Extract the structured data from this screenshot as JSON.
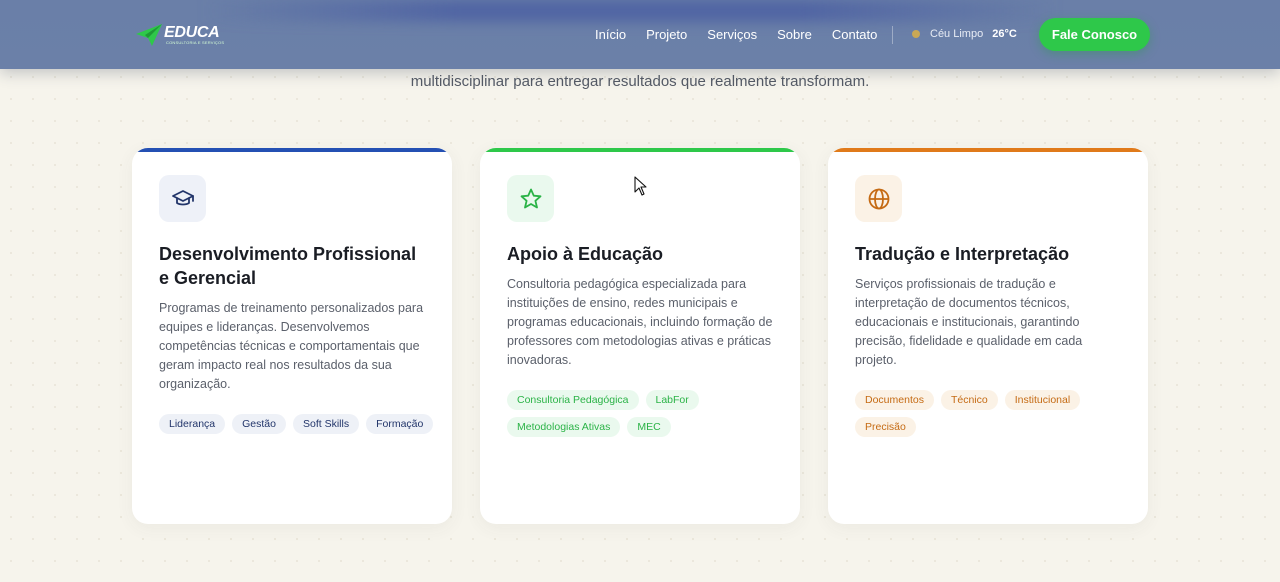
{
  "header": {
    "logo_text": "EDUCA",
    "logo_sub": "CONSULTORIA E SERVIÇOS",
    "nav": [
      "Início",
      "Projeto",
      "Serviços",
      "Sobre",
      "Contato"
    ],
    "weather": {
      "condition": "Céu Limpo",
      "temp": "26°C"
    },
    "cta_label": "Fale Conosco"
  },
  "subtitle": "multidisciplinar para entregar resultados que realmente transformam.",
  "cards": [
    {
      "icon": "graduation-cap-icon",
      "accent": "#2450b3",
      "title": "Desenvolvimento Profissional e Gerencial",
      "description": "Programas de treinamento personalizados para equipes e lideranças. Desenvolvemos competências técnicas e comportamentais que geram impacto real nos resultados da sua organização.",
      "tags": [
        "Liderança",
        "Gestão",
        "Soft Skills",
        "Formação"
      ]
    },
    {
      "icon": "star-icon",
      "accent": "#2ec84a",
      "title": "Apoio à Educação",
      "description": "Consultoria pedagógica especializada para instituições de ensino, redes municipais e programas educacionais, incluindo formação de professores com metodologias ativas e práticas inovadoras.",
      "tags": [
        "Consultoria Pedagógica",
        "LabFor",
        "Metodologias Ativas",
        "MEC"
      ]
    },
    {
      "icon": "globe-icon",
      "accent": "#e07a1a",
      "title": "Tradução e Interpretação",
      "description": "Serviços profissionais de tradução e interpretação de documentos técnicos, educacionais e institucionais, garantindo precisão, fidelidade e qualidade em cada projeto.",
      "tags": [
        "Documentos",
        "Técnico",
        "Institucional",
        "Precisão"
      ]
    }
  ]
}
